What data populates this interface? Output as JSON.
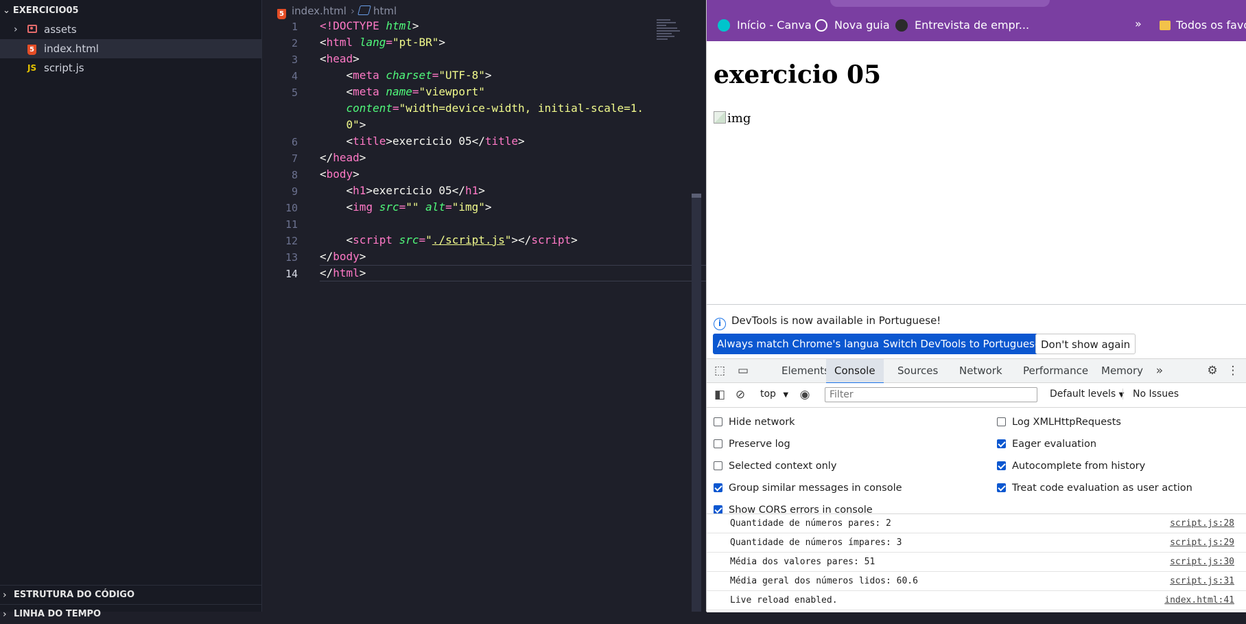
{
  "explorer": {
    "folder": "EXERCICIO05",
    "items": [
      {
        "label": "assets",
        "type": "folder"
      },
      {
        "label": "index.html",
        "type": "html",
        "active": true
      },
      {
        "label": "script.js",
        "type": "js"
      }
    ],
    "outline_label": "ESTRUTURA DO CÓDIGO",
    "timeline_label": "LINHA DO TEMPO"
  },
  "editor": {
    "breadcrumb": {
      "file": "index.html",
      "node": "html"
    },
    "line_numbers": [
      "1",
      "2",
      "3",
      "4",
      "5",
      "",
      "",
      "6",
      "7",
      "8",
      "9",
      "10",
      "11",
      "12",
      "13",
      "14"
    ],
    "code": {
      "l1_doctype": "<!DOCTYPE",
      "l1_html": "html",
      "l1_end": ">",
      "l2_open": "<",
      "l2_tag": "html",
      "l2_attr": "lang",
      "l2_eq": "=",
      "l2_val": "\"pt-BR\"",
      "l2_end": ">",
      "l3_open": "<",
      "l3_tag": "head",
      "l3_end": ">",
      "l4_tag": "meta",
      "l4_attr": "charset",
      "l4_val": "\"UTF-8\"",
      "l5_tag": "meta",
      "l5_attr": "name",
      "l5_val": "\"viewport\"",
      "l5b_attr": "content",
      "l5b_val": "\"width=device-width, initial-scale=1.",
      "l5c_val": "0\"",
      "l6_tag": "title",
      "l6_text": "exercicio 05",
      "l6_close": "title",
      "l7_close": "head",
      "l8_tag": "body",
      "l9_tag": "h1",
      "l9_text": "exercicio 05",
      "l9_close": "h1",
      "l10_tag": "img",
      "l10_attr1": "src",
      "l10_val1": "\"\"",
      "l10_attr2": "alt",
      "l10_val2": "\"img\"",
      "l12_tag": "script",
      "l12_attr": "src",
      "l12_val_q1": "\"",
      "l12_val": "./script.js",
      "l12_val_q2": "\"",
      "l12_close": "script",
      "l13_close": "body",
      "l14_close": "html"
    }
  },
  "browser": {
    "bookmarks": [
      {
        "label": "Início - Canva",
        "icon": "canva-icon",
        "color": "#00c4cc"
      },
      {
        "label": "Nova guia",
        "icon": "globe-icon",
        "color": "#ffffff"
      },
      {
        "label": "Entrevista de empr...",
        "icon": "g-icon",
        "color": "#2b2b2b"
      }
    ],
    "more_label": "»",
    "all_favorites": "Todos os favori",
    "page": {
      "h1": "exercicio 05",
      "img_alt": "img"
    }
  },
  "devtools": {
    "notice": "DevTools is now available in Portuguese!",
    "btn_match": "Always match Chrome's language",
    "btn_switch": "Switch DevTools to Portuguese",
    "btn_dont": "Don't show again",
    "tabs": [
      "Elements",
      "Console",
      "Sources",
      "Network",
      "Performance",
      "Memory"
    ],
    "active_tab": "Console",
    "context": "top",
    "filter_placeholder": "Filter",
    "levels": "Default levels",
    "issues": "No Issues",
    "options_left": [
      {
        "label": "Hide network",
        "checked": false
      },
      {
        "label": "Preserve log",
        "checked": false
      },
      {
        "label": "Selected context only",
        "checked": false
      },
      {
        "label": "Group similar messages in console",
        "checked": true
      },
      {
        "label": "Show CORS errors in console",
        "checked": true
      }
    ],
    "options_right": [
      {
        "label": "Log XMLHttpRequests",
        "checked": false
      },
      {
        "label": "Eager evaluation",
        "checked": true
      },
      {
        "label": "Autocomplete from history",
        "checked": true
      },
      {
        "label": "Treat code evaluation as user action",
        "checked": true
      }
    ],
    "logs": [
      {
        "msg": "Quantidade de números pares: 2",
        "src": "script.js:28"
      },
      {
        "msg": "Quantidade de números ímpares: 3",
        "src": "script.js:29"
      },
      {
        "msg": "Média dos valores pares: 51",
        "src": "script.js:30"
      },
      {
        "msg": "Média geral dos números lidos: 60.6",
        "src": "script.js:31"
      },
      {
        "msg": "Live reload enabled.",
        "src": "index.html:41"
      }
    ]
  }
}
